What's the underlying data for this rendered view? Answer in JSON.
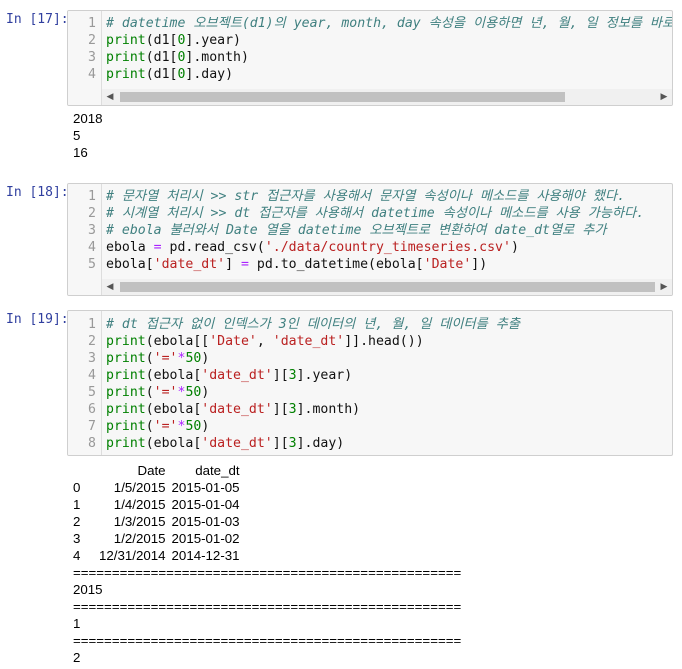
{
  "cells": [
    {
      "prompt": "In [17]:",
      "lines": [
        {
          "n": "1",
          "parts": [
            {
              "t": "# datetime 오브젝트(d1)의 year, month, day 속성을 이용하면 년, 월, 일 정보를 바로",
              "c": "cm"
            }
          ]
        },
        {
          "n": "2",
          "parts": [
            {
              "t": "print",
              "c": "kw"
            },
            {
              "t": "(d1[",
              "c": ""
            },
            {
              "t": "0",
              "c": "nm"
            },
            {
              "t": "].year)",
              "c": ""
            }
          ]
        },
        {
          "n": "3",
          "parts": [
            {
              "t": "print",
              "c": "kw"
            },
            {
              "t": "(d1[",
              "c": ""
            },
            {
              "t": "0",
              "c": "nm"
            },
            {
              "t": "].month)",
              "c": ""
            }
          ]
        },
        {
          "n": "4",
          "parts": [
            {
              "t": "print",
              "c": "kw"
            },
            {
              "t": "(d1[",
              "c": ""
            },
            {
              "t": "0",
              "c": "nm"
            },
            {
              "t": "].day)",
              "c": ""
            }
          ]
        }
      ],
      "output": [
        "2018",
        "5",
        "16"
      ]
    },
    {
      "prompt": "In [18]:",
      "lines": [
        {
          "n": "1",
          "parts": [
            {
              "t": "# 문자열 처리시 >> str 접근자를 사용해서 문자열 속성이나 메소드를 사용해야 했다.",
              "c": "cm"
            }
          ]
        },
        {
          "n": "2",
          "parts": [
            {
              "t": "# 시계열 처리시 >> dt 접근자를 사용해서 datetime 속성이나 메소드를 사용 가능하다.",
              "c": "cm"
            }
          ]
        },
        {
          "n": "3",
          "parts": [
            {
              "t": "# ebola 불러와서 Date 열을 datetime 오브젝트로 변환하여 date_dt열로 추가",
              "c": "cm"
            }
          ]
        },
        {
          "n": "4",
          "parts": [
            {
              "t": "ebola ",
              "c": ""
            },
            {
              "t": "=",
              "c": "op"
            },
            {
              "t": " pd.read_csv(",
              "c": ""
            },
            {
              "t": "'./data/country_timeseries.csv'",
              "c": "st"
            },
            {
              "t": ")",
              "c": ""
            }
          ]
        },
        {
          "n": "5",
          "parts": [
            {
              "t": "ebola[",
              "c": ""
            },
            {
              "t": "'date_dt'",
              "c": "st"
            },
            {
              "t": "] ",
              "c": ""
            },
            {
              "t": "=",
              "c": "op"
            },
            {
              "t": " pd.to_datetime(ebola[",
              "c": ""
            },
            {
              "t": "'Date'",
              "c": "st"
            },
            {
              "t": "])",
              "c": ""
            }
          ]
        }
      ]
    },
    {
      "prompt": "In [19]:",
      "lines": [
        {
          "n": "1",
          "parts": [
            {
              "t": "# dt 접근자 없이 인덱스가 3인 데이터의 년, 월, 일 데이터를 추출",
              "c": "cm"
            }
          ]
        },
        {
          "n": "2",
          "parts": [
            {
              "t": "print",
              "c": "kw"
            },
            {
              "t": "(ebola[[",
              "c": ""
            },
            {
              "t": "'Date'",
              "c": "st"
            },
            {
              "t": ", ",
              "c": ""
            },
            {
              "t": "'date_dt'",
              "c": "st"
            },
            {
              "t": "]].head())",
              "c": ""
            }
          ]
        },
        {
          "n": "3",
          "parts": [
            {
              "t": "print",
              "c": "kw"
            },
            {
              "t": "(",
              "c": ""
            },
            {
              "t": "'='",
              "c": "st"
            },
            {
              "t": "*",
              "c": "op"
            },
            {
              "t": "50",
              "c": "nm"
            },
            {
              "t": ")",
              "c": ""
            }
          ]
        },
        {
          "n": "4",
          "parts": [
            {
              "t": "print",
              "c": "kw"
            },
            {
              "t": "(ebola[",
              "c": ""
            },
            {
              "t": "'date_dt'",
              "c": "st"
            },
            {
              "t": "][",
              "c": ""
            },
            {
              "t": "3",
              "c": "nm"
            },
            {
              "t": "].year)",
              "c": ""
            }
          ]
        },
        {
          "n": "5",
          "parts": [
            {
              "t": "print",
              "c": "kw"
            },
            {
              "t": "(",
              "c": ""
            },
            {
              "t": "'='",
              "c": "st"
            },
            {
              "t": "*",
              "c": "op"
            },
            {
              "t": "50",
              "c": "nm"
            },
            {
              "t": ")",
              "c": ""
            }
          ]
        },
        {
          "n": "6",
          "parts": [
            {
              "t": "print",
              "c": "kw"
            },
            {
              "t": "(ebola[",
              "c": ""
            },
            {
              "t": "'date_dt'",
              "c": "st"
            },
            {
              "t": "][",
              "c": ""
            },
            {
              "t": "3",
              "c": "nm"
            },
            {
              "t": "].month)",
              "c": ""
            }
          ]
        },
        {
          "n": "7",
          "parts": [
            {
              "t": "print",
              "c": "kw"
            },
            {
              "t": "(",
              "c": ""
            },
            {
              "t": "'='",
              "c": "st"
            },
            {
              "t": "*",
              "c": "op"
            },
            {
              "t": "50",
              "c": "nm"
            },
            {
              "t": ")",
              "c": ""
            }
          ]
        },
        {
          "n": "8",
          "parts": [
            {
              "t": "print",
              "c": "kw"
            },
            {
              "t": "(ebola[",
              "c": ""
            },
            {
              "t": "'date_dt'",
              "c": "st"
            },
            {
              "t": "][",
              "c": ""
            },
            {
              "t": "3",
              "c": "nm"
            },
            {
              "t": "].day)",
              "c": ""
            }
          ]
        }
      ],
      "table": {
        "headers": [
          "",
          "Date",
          "date_dt"
        ],
        "rows": [
          [
            "0",
            "1/5/2015",
            "2015-01-05"
          ],
          [
            "1",
            "1/4/2015",
            "2015-01-04"
          ],
          [
            "2",
            "1/3/2015",
            "2015-01-03"
          ],
          [
            "3",
            "1/2/2015",
            "2015-01-02"
          ],
          [
            "4",
            "12/31/2014",
            "2014-12-31"
          ]
        ]
      },
      "output_after": [
        "==================================================",
        "2015",
        "==================================================",
        "1",
        "==================================================",
        "2"
      ]
    }
  ],
  "colors": {
    "comment": "#408080",
    "keyword": "#008000",
    "string": "#ba2121",
    "operator": "#aa22ff",
    "prompt": "#303f9f"
  }
}
